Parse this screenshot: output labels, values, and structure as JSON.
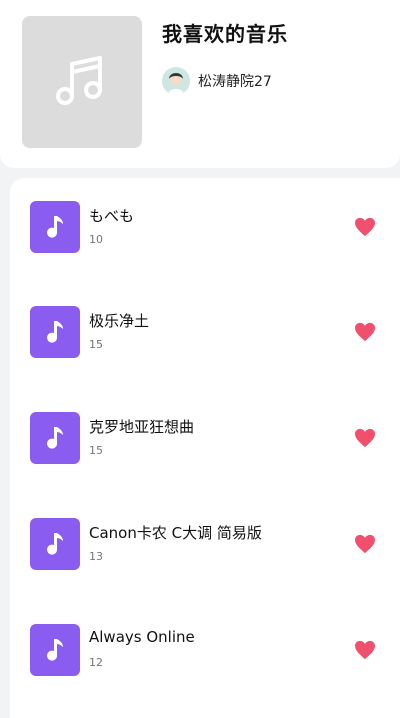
{
  "playlist": {
    "title": "我喜欢的音乐",
    "owner": "松涛静院27",
    "cover_icon": "music-note-icon"
  },
  "colors": {
    "accent": "#8a5cf0",
    "heart": "#f0506e",
    "cover_bg": "#dcdcdc"
  },
  "songs": [
    {
      "title": "もべも",
      "count": "10"
    },
    {
      "title": "极乐净土",
      "count": "15"
    },
    {
      "title": "克罗地亚狂想曲",
      "count": "15"
    },
    {
      "title": "Canon卡农 C大调 简易版",
      "count": "13"
    },
    {
      "title": "Always Online",
      "count": "12"
    }
  ]
}
